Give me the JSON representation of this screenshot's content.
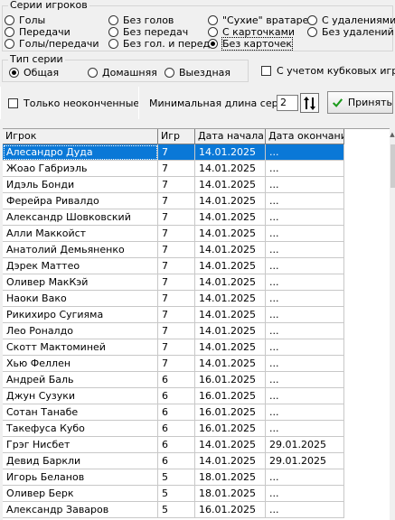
{
  "series_group": {
    "title": "Серии игроков",
    "options": [
      "Голы",
      "Передачи",
      "Голы/передачи",
      "Без голов",
      "Без передач",
      "Без гол. и перед.",
      "\"Сухие\" вратарей",
      "С карточками",
      "Без карточек",
      "С удалениями",
      "Без удалений"
    ],
    "selected": "Без карточек"
  },
  "type_group": {
    "title": "Тип серии",
    "options": [
      "Общая",
      "Домашняя",
      "Выездная"
    ],
    "selected": "Общая"
  },
  "cup_checkbox": {
    "label": "С учетом кубковых игр",
    "checked": false
  },
  "unfinished_checkbox": {
    "label": "Только неоконченные",
    "checked": false
  },
  "min_length": {
    "label": "Минимальная длина серии",
    "value": "2"
  },
  "apply_button": {
    "label": "Принять"
  },
  "table": {
    "columns": [
      "Игрок",
      "Игр",
      "Дата начала",
      "Дата окончания"
    ],
    "rows": [
      [
        "Алесандро Дуда",
        "7",
        "14.01.2025",
        "..."
      ],
      [
        "Жоао Габриэль",
        "7",
        "14.01.2025",
        "..."
      ],
      [
        "Идэль Бонди",
        "7",
        "14.01.2025",
        "..."
      ],
      [
        "Ферейра Ривалдо",
        "7",
        "14.01.2025",
        "..."
      ],
      [
        "Александр Шовковский",
        "7",
        "14.01.2025",
        "..."
      ],
      [
        "Алли Маккойст",
        "7",
        "14.01.2025",
        "..."
      ],
      [
        "Анатолий Демьяненко",
        "7",
        "14.01.2025",
        "..."
      ],
      [
        "Дэрек Маттео",
        "7",
        "14.01.2025",
        "..."
      ],
      [
        "Оливер МакКэй",
        "7",
        "14.01.2025",
        "..."
      ],
      [
        "Наоки Вако",
        "7",
        "14.01.2025",
        "..."
      ],
      [
        "Рикихиро Сугияма",
        "7",
        "14.01.2025",
        "..."
      ],
      [
        "Лео Роналдо",
        "7",
        "14.01.2025",
        "..."
      ],
      [
        "Скотт Мактоминей",
        "7",
        "14.01.2025",
        "..."
      ],
      [
        "Хью Феллен",
        "7",
        "14.01.2025",
        "..."
      ],
      [
        "Андрей Баль",
        "6",
        "16.01.2025",
        "..."
      ],
      [
        "Джун Сузуки",
        "6",
        "16.01.2025",
        "..."
      ],
      [
        "Сотан Танабе",
        "6",
        "16.01.2025",
        "..."
      ],
      [
        "Такефуса Кубо",
        "6",
        "16.01.2025",
        "..."
      ],
      [
        "Грэг Нисбет",
        "6",
        "14.01.2025",
        "29.01.2025"
      ],
      [
        "Девид Баркли",
        "6",
        "14.01.2025",
        "29.01.2025"
      ],
      [
        "Игорь Беланов",
        "5",
        "18.01.2025",
        "..."
      ],
      [
        "Оливер Берк",
        "5",
        "18.01.2025",
        "..."
      ],
      [
        "Александр Заваров",
        "5",
        "16.01.2025",
        "..."
      ]
    ],
    "selected_row": 0
  },
  "colors": {
    "selection": "#0a78d7",
    "apply_check": "#1a9a1a"
  }
}
